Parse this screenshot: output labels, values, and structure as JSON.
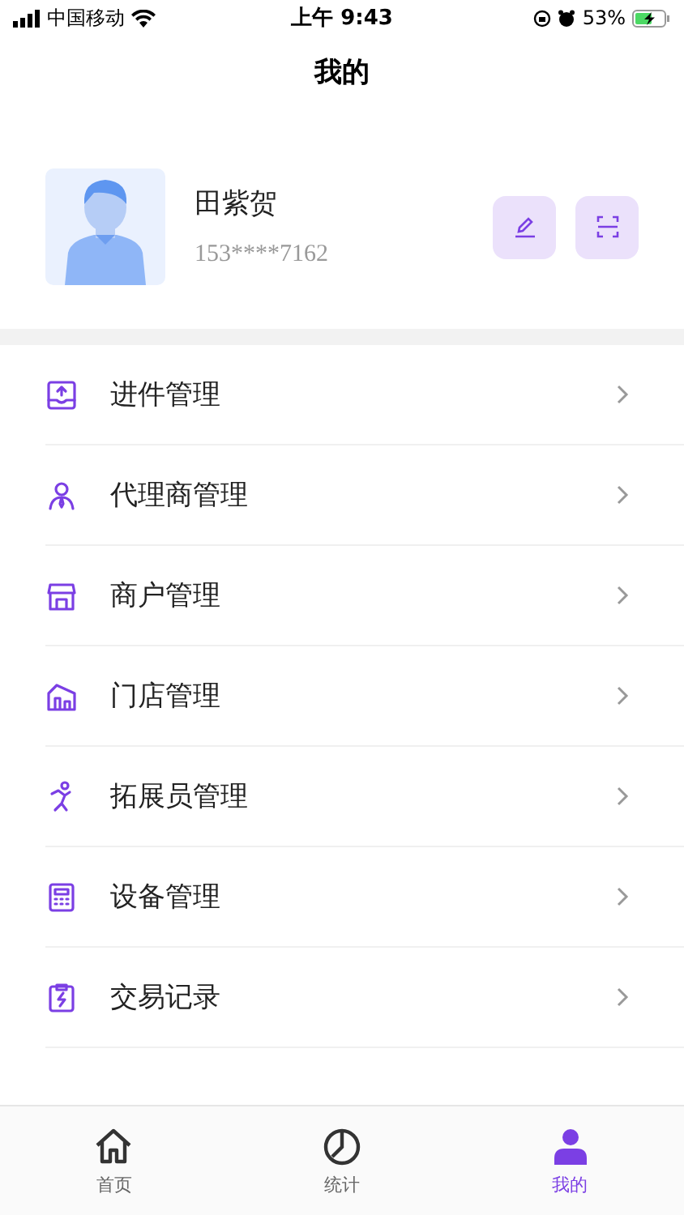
{
  "status_bar": {
    "carrier": "中国移动",
    "time": "上午 9:43",
    "battery": "53%"
  },
  "title": "我的",
  "profile": {
    "name": "田紫贺",
    "phone": "153****7162"
  },
  "menu": [
    {
      "label": "进件管理"
    },
    {
      "label": "代理商管理"
    },
    {
      "label": "商户管理"
    },
    {
      "label": "门店管理"
    },
    {
      "label": "拓展员管理"
    },
    {
      "label": "设备管理"
    },
    {
      "label": "交易记录"
    }
  ],
  "tabs": [
    {
      "label": "首页",
      "selected": false
    },
    {
      "label": "统计",
      "selected": false
    },
    {
      "label": "我的",
      "selected": true
    }
  ]
}
